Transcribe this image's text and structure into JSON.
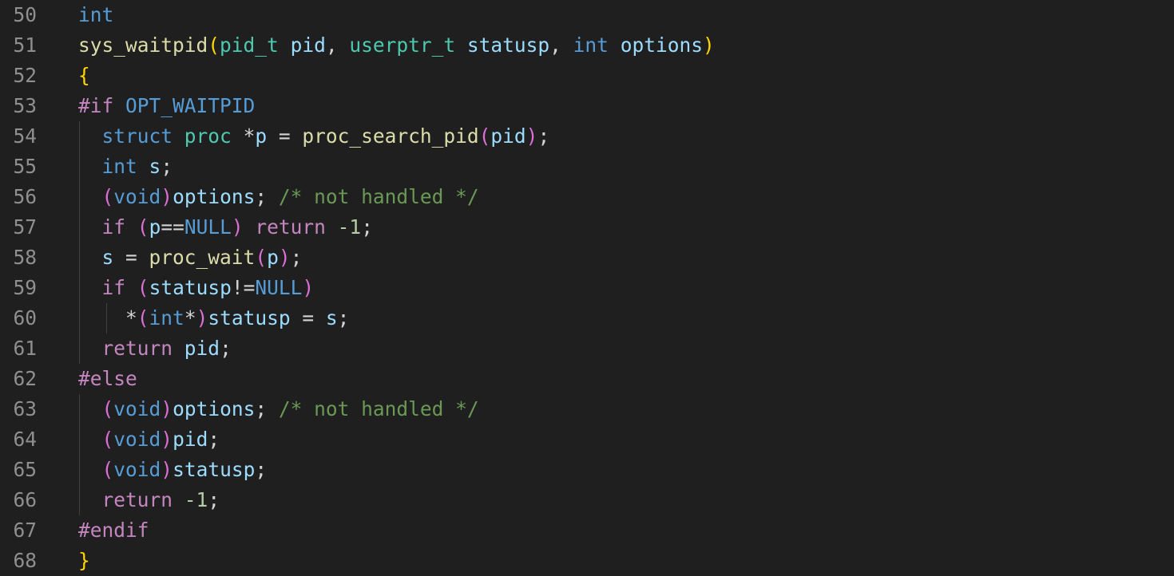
{
  "editor": {
    "background": "#1f1f1f",
    "colors": {
      "kw": "#569cd6",
      "ctl": "#c586c0",
      "fn": "#dcdcaa",
      "type": "#4ec9b0",
      "var": "#9cdcfe",
      "num": "#b5cea8",
      "com": "#6a9955",
      "pl": "#d4d4d4",
      "br1": "#ffd700",
      "br2": "#da70d6",
      "mac": "#569cd6"
    },
    "lines": [
      {
        "num": "50",
        "tokens": [
          {
            "t": "int",
            "c": "kw"
          }
        ]
      },
      {
        "num": "51",
        "tokens": [
          {
            "t": "sys_waitpid",
            "c": "fn"
          },
          {
            "t": "(",
            "c": "br1"
          },
          {
            "t": "pid_t",
            "c": "type"
          },
          {
            "t": " ",
            "c": "pl"
          },
          {
            "t": "pid",
            "c": "var"
          },
          {
            "t": ", ",
            "c": "pl"
          },
          {
            "t": "userptr_t",
            "c": "type"
          },
          {
            "t": " ",
            "c": "pl"
          },
          {
            "t": "statusp",
            "c": "var"
          },
          {
            "t": ", ",
            "c": "pl"
          },
          {
            "t": "int",
            "c": "kw"
          },
          {
            "t": " ",
            "c": "pl"
          },
          {
            "t": "options",
            "c": "var"
          },
          {
            "t": ")",
            "c": "br1"
          }
        ]
      },
      {
        "num": "52",
        "tokens": [
          {
            "t": "{",
            "c": "br1"
          }
        ]
      },
      {
        "num": "53",
        "tokens": [
          {
            "t": "#if",
            "c": "ctl"
          },
          {
            "t": " ",
            "c": "pl"
          },
          {
            "t": "OPT_WAITPID",
            "c": "mac"
          }
        ]
      },
      {
        "num": "54",
        "tokens": [
          {
            "t": "  ",
            "c": "pl"
          },
          {
            "t": "struct",
            "c": "kw"
          },
          {
            "t": " ",
            "c": "pl"
          },
          {
            "t": "proc",
            "c": "type"
          },
          {
            "t": " ",
            "c": "pl"
          },
          {
            "t": "*",
            "c": "pl"
          },
          {
            "t": "p",
            "c": "var"
          },
          {
            "t": " = ",
            "c": "pl"
          },
          {
            "t": "proc_search_pid",
            "c": "fn"
          },
          {
            "t": "(",
            "c": "br2"
          },
          {
            "t": "pid",
            "c": "var"
          },
          {
            "t": ")",
            "c": "br2"
          },
          {
            "t": ";",
            "c": "pl"
          }
        ]
      },
      {
        "num": "55",
        "tokens": [
          {
            "t": "  ",
            "c": "pl"
          },
          {
            "t": "int",
            "c": "kw"
          },
          {
            "t": " ",
            "c": "pl"
          },
          {
            "t": "s",
            "c": "var"
          },
          {
            "t": ";",
            "c": "pl"
          }
        ]
      },
      {
        "num": "56",
        "tokens": [
          {
            "t": "  ",
            "c": "pl"
          },
          {
            "t": "(",
            "c": "br2"
          },
          {
            "t": "void",
            "c": "kw"
          },
          {
            "t": ")",
            "c": "br2"
          },
          {
            "t": "options",
            "c": "var"
          },
          {
            "t": "; ",
            "c": "pl"
          },
          {
            "t": "/* not handled */",
            "c": "com"
          }
        ]
      },
      {
        "num": "57",
        "tokens": [
          {
            "t": "  ",
            "c": "pl"
          },
          {
            "t": "if",
            "c": "ctl"
          },
          {
            "t": " ",
            "c": "pl"
          },
          {
            "t": "(",
            "c": "br2"
          },
          {
            "t": "p",
            "c": "var"
          },
          {
            "t": "==",
            "c": "pl"
          },
          {
            "t": "NULL",
            "c": "kw"
          },
          {
            "t": ")",
            "c": "br2"
          },
          {
            "t": " ",
            "c": "pl"
          },
          {
            "t": "return",
            "c": "ctl"
          },
          {
            "t": " ",
            "c": "pl"
          },
          {
            "t": "-1",
            "c": "num"
          },
          {
            "t": ";",
            "c": "pl"
          }
        ]
      },
      {
        "num": "58",
        "tokens": [
          {
            "t": "  ",
            "c": "pl"
          },
          {
            "t": "s",
            "c": "var"
          },
          {
            "t": " = ",
            "c": "pl"
          },
          {
            "t": "proc_wait",
            "c": "fn"
          },
          {
            "t": "(",
            "c": "br2"
          },
          {
            "t": "p",
            "c": "var"
          },
          {
            "t": ")",
            "c": "br2"
          },
          {
            "t": ";",
            "c": "pl"
          }
        ]
      },
      {
        "num": "59",
        "tokens": [
          {
            "t": "  ",
            "c": "pl"
          },
          {
            "t": "if",
            "c": "ctl"
          },
          {
            "t": " ",
            "c": "pl"
          },
          {
            "t": "(",
            "c": "br2"
          },
          {
            "t": "statusp",
            "c": "var"
          },
          {
            "t": "!=",
            "c": "pl"
          },
          {
            "t": "NULL",
            "c": "kw"
          },
          {
            "t": ")",
            "c": "br2"
          }
        ]
      },
      {
        "num": "60",
        "tokens": [
          {
            "t": "    ",
            "c": "pl"
          },
          {
            "t": "*",
            "c": "pl"
          },
          {
            "t": "(",
            "c": "br2"
          },
          {
            "t": "int",
            "c": "kw"
          },
          {
            "t": "*",
            "c": "pl"
          },
          {
            "t": ")",
            "c": "br2"
          },
          {
            "t": "statusp",
            "c": "var"
          },
          {
            "t": " = ",
            "c": "pl"
          },
          {
            "t": "s",
            "c": "var"
          },
          {
            "t": ";",
            "c": "pl"
          }
        ]
      },
      {
        "num": "61",
        "tokens": [
          {
            "t": "  ",
            "c": "pl"
          },
          {
            "t": "return",
            "c": "ctl"
          },
          {
            "t": " ",
            "c": "pl"
          },
          {
            "t": "pid",
            "c": "var"
          },
          {
            "t": ";",
            "c": "pl"
          }
        ]
      },
      {
        "num": "62",
        "tokens": [
          {
            "t": "#else",
            "c": "ctl"
          }
        ]
      },
      {
        "num": "63",
        "tokens": [
          {
            "t": "  ",
            "c": "pl"
          },
          {
            "t": "(",
            "c": "br2"
          },
          {
            "t": "void",
            "c": "kw"
          },
          {
            "t": ")",
            "c": "br2"
          },
          {
            "t": "options",
            "c": "var"
          },
          {
            "t": "; ",
            "c": "pl"
          },
          {
            "t": "/* not handled */",
            "c": "com"
          }
        ]
      },
      {
        "num": "64",
        "tokens": [
          {
            "t": "  ",
            "c": "pl"
          },
          {
            "t": "(",
            "c": "br2"
          },
          {
            "t": "void",
            "c": "kw"
          },
          {
            "t": ")",
            "c": "br2"
          },
          {
            "t": "pid",
            "c": "var"
          },
          {
            "t": ";",
            "c": "pl"
          }
        ]
      },
      {
        "num": "65",
        "tokens": [
          {
            "t": "  ",
            "c": "pl"
          },
          {
            "t": "(",
            "c": "br2"
          },
          {
            "t": "void",
            "c": "kw"
          },
          {
            "t": ")",
            "c": "br2"
          },
          {
            "t": "statusp",
            "c": "var"
          },
          {
            "t": ";",
            "c": "pl"
          }
        ]
      },
      {
        "num": "66",
        "tokens": [
          {
            "t": "  ",
            "c": "pl"
          },
          {
            "t": "return",
            "c": "ctl"
          },
          {
            "t": " ",
            "c": "pl"
          },
          {
            "t": "-1",
            "c": "num"
          },
          {
            "t": ";",
            "c": "pl"
          }
        ]
      },
      {
        "num": "67",
        "tokens": [
          {
            "t": "#endif",
            "c": "ctl"
          }
        ]
      },
      {
        "num": "68",
        "tokens": [
          {
            "t": "}",
            "c": "br1"
          }
        ]
      }
    ]
  }
}
